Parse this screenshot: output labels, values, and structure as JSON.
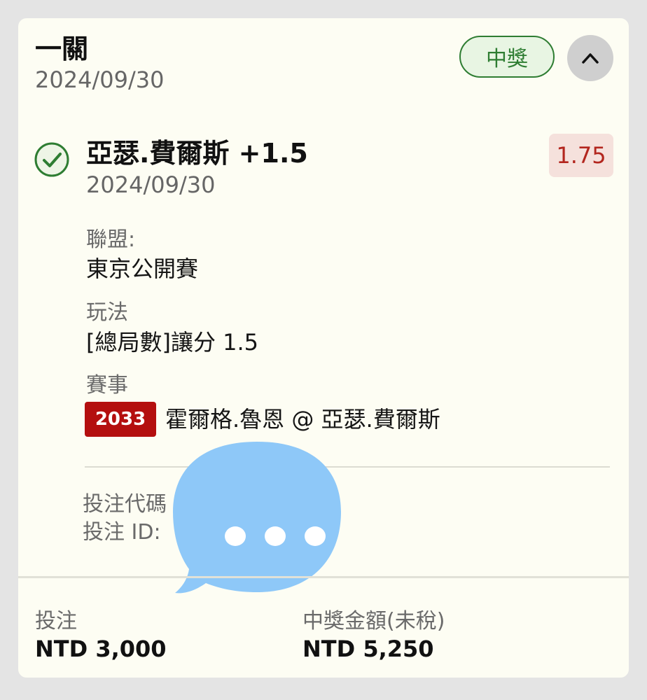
{
  "header": {
    "bet_type": "一關",
    "date": "2024/09/30",
    "status_badge": "中獎"
  },
  "selection": {
    "title": "亞瑟.費爾斯 +1.5",
    "date": "2024/09/30",
    "odds": "1.75",
    "league_label": "聯盟:",
    "league_value": "東京公開賽",
    "market_label": "玩法",
    "market_value": "[總局數]讓分 1.5",
    "event_label": "賽事",
    "event_id": "2033",
    "event_name": "霍爾格.魯恩 @ 亞瑟.費爾斯"
  },
  "bet_info": {
    "code_label": "投注代碼",
    "id_label": "投注 ID:"
  },
  "footer": {
    "stake_label": "投注",
    "stake_value": "NTD 3,000",
    "payout_label": "中獎金額(未稅)",
    "payout_value": "NTD 5,250"
  },
  "icons": {
    "check": "check-circle-icon",
    "collapse": "chevron-up-icon",
    "overlay": "chat-bubble-icon"
  },
  "colors": {
    "win_green": "#2e7d32",
    "odds_red": "#b3261e",
    "event_tag_red": "#b40f0f",
    "card_bg": "#fdfdf3",
    "bubble_blue": "#8ec8f8"
  }
}
